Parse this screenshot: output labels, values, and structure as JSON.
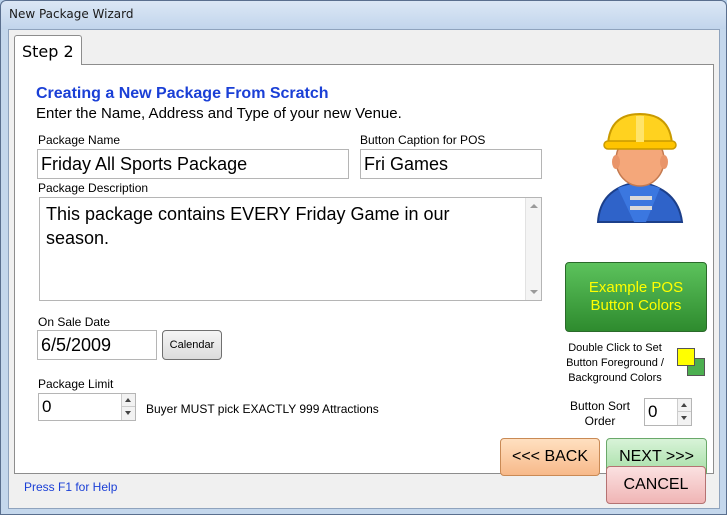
{
  "window": {
    "title": "New Package Wizard"
  },
  "tab": {
    "label": "Step 2"
  },
  "header": {
    "title": "Creating a New Package From Scratch",
    "subtitle": "Enter the Name, Address and Type of your new Venue."
  },
  "fields": {
    "package_name_label": "Package Name",
    "package_name_value": "Friday All Sports Package",
    "caption_label": "Button Caption for POS",
    "caption_value": "Fri Games",
    "description_label": "Package Description",
    "description_value": "This package contains EVERY Friday Game in our season.",
    "on_sale_label": "On Sale Date",
    "on_sale_value": "6/5/2009",
    "calendar_button": "Calendar",
    "limit_label": "Package Limit",
    "limit_value": "0",
    "buyer_note": "Buyer MUST pick EXACTLY 999 Attractions"
  },
  "pos_preview": {
    "button_text": "Example POS Button Colors",
    "color_hint": "Double Click to Set Button Foreground / Background Colors",
    "foreground_color": "#ffff00",
    "background_color": "#4caf50",
    "sort_label": "Button Sort Order",
    "sort_value": "0"
  },
  "nav": {
    "back": "<<< BACK",
    "next": "NEXT >>>",
    "cancel": "CANCEL"
  },
  "footer": {
    "help": "Press F1 for Help"
  },
  "icons": {
    "worker": "construction-worker-icon"
  }
}
